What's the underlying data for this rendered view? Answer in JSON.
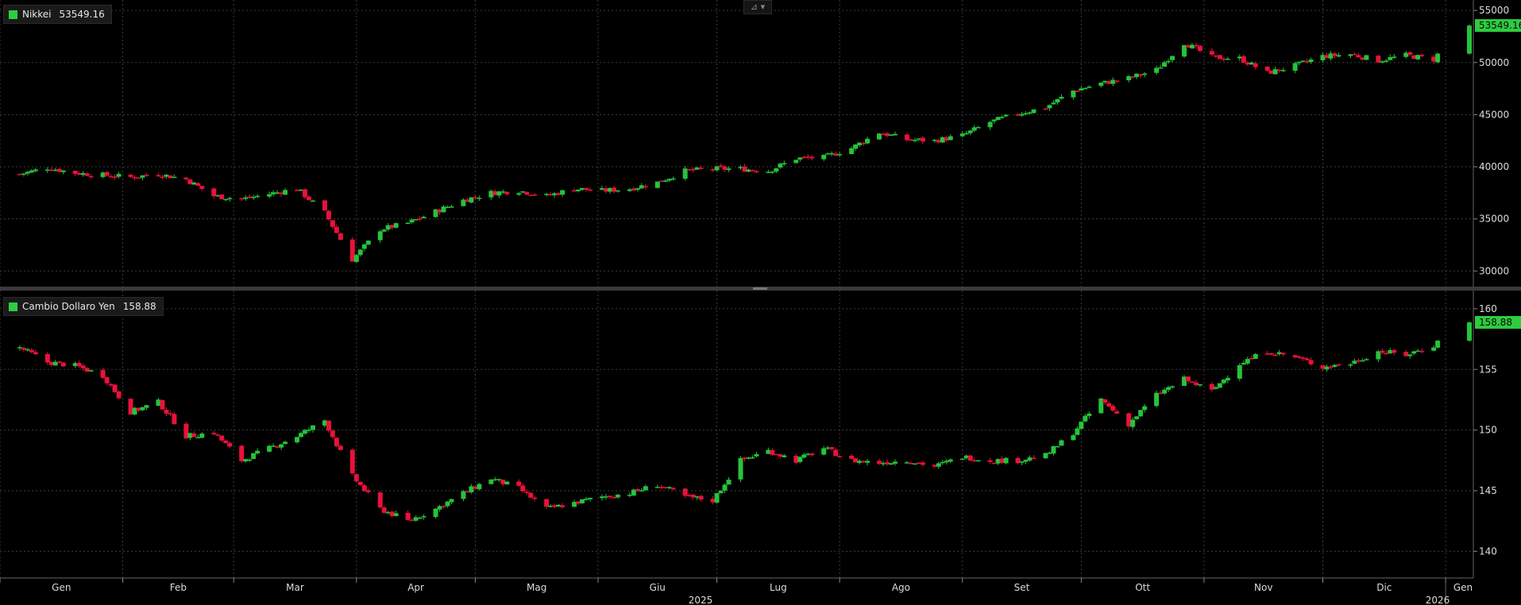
{
  "chart_data": [
    {
      "type": "candlestick",
      "series_name": "Nikkei",
      "last_value": "53549.16",
      "ylim": [
        28500,
        56000
      ],
      "y_ticks": [
        "55000",
        "50000",
        "45000",
        "40000",
        "35000",
        "30000"
      ],
      "grid": true,
      "x": [
        "2025-01-06",
        "2025-01-13",
        "2025-01-20",
        "2025-01-27",
        "2025-02-03",
        "2025-02-10",
        "2025-02-17",
        "2025-02-24",
        "2025-03-03",
        "2025-03-10",
        "2025-03-17",
        "2025-03-24",
        "2025-03-31",
        "2025-04-07",
        "2025-04-14",
        "2025-04-21",
        "2025-04-28",
        "2025-05-05",
        "2025-05-12",
        "2025-05-19",
        "2025-05-26",
        "2025-06-02",
        "2025-06-09",
        "2025-06-16",
        "2025-06-23",
        "2025-06-30",
        "2025-07-07",
        "2025-07-14",
        "2025-07-21",
        "2025-07-28",
        "2025-08-04",
        "2025-08-11",
        "2025-08-18",
        "2025-08-25",
        "2025-09-01",
        "2025-09-08",
        "2025-09-15",
        "2025-09-22",
        "2025-09-29",
        "2025-10-06",
        "2025-10-13",
        "2025-10-20",
        "2025-10-27",
        "2025-11-03",
        "2025-11-10",
        "2025-11-17",
        "2025-11-24",
        "2025-12-01",
        "2025-12-08",
        "2025-12-15",
        "2025-12-22",
        "2025-12-29",
        "2026-01-05"
      ],
      "values": [
        39300,
        39900,
        39400,
        39200,
        39000,
        39300,
        38800,
        37200,
        36900,
        37400,
        37900,
        35600,
        31100,
        34000,
        34600,
        35700,
        36800,
        37500,
        37700,
        37200,
        37900,
        37700,
        37900,
        38500,
        39600,
        39800,
        39800,
        39600,
        40800,
        40900,
        41800,
        43300,
        42600,
        42500,
        43000,
        44300,
        45100,
        45700,
        47300,
        48000,
        48500,
        49300,
        51900,
        50500,
        50400,
        49000,
        49700,
        50600,
        50800,
        50200,
        50700,
        50300,
        53549.16
      ]
    },
    {
      "type": "candlestick",
      "series_name": "Cambio Dollaro Yen",
      "last_value": "158.88",
      "ylim": [
        137.8,
        161.5
      ],
      "y_ticks": [
        "160",
        "155",
        "150",
        "145",
        "140"
      ],
      "grid": true,
      "x": [
        "2025-01-06",
        "2025-01-13",
        "2025-01-20",
        "2025-01-27",
        "2025-02-03",
        "2025-02-10",
        "2025-02-17",
        "2025-02-24",
        "2025-03-03",
        "2025-03-10",
        "2025-03-17",
        "2025-03-24",
        "2025-03-31",
        "2025-04-07",
        "2025-04-14",
        "2025-04-21",
        "2025-04-28",
        "2025-05-05",
        "2025-05-12",
        "2025-05-19",
        "2025-05-26",
        "2025-06-02",
        "2025-06-09",
        "2025-06-16",
        "2025-06-23",
        "2025-06-30",
        "2025-07-07",
        "2025-07-14",
        "2025-07-21",
        "2025-07-28",
        "2025-08-04",
        "2025-08-11",
        "2025-08-18",
        "2025-08-25",
        "2025-09-01",
        "2025-09-08",
        "2025-09-15",
        "2025-09-22",
        "2025-09-29",
        "2025-10-06",
        "2025-10-13",
        "2025-10-20",
        "2025-10-27",
        "2025-11-03",
        "2025-11-10",
        "2025-11-17",
        "2025-11-24",
        "2025-12-01",
        "2025-12-08",
        "2025-12-15",
        "2025-12-22",
        "2025-12-29",
        "2026-01-05"
      ],
      "values": [
        156.8,
        155.6,
        155.3,
        154.5,
        151.5,
        152.3,
        149.5,
        149.8,
        147.5,
        148.5,
        149.5,
        150.8,
        146.2,
        143.5,
        142.5,
        143.5,
        144.8,
        146.0,
        145.2,
        143.5,
        144.0,
        144.5,
        144.8,
        145.5,
        144.5,
        144.2,
        147.5,
        148.3,
        147.5,
        148.5,
        147.5,
        147.3,
        147.5,
        147.0,
        147.8,
        147.5,
        147.5,
        147.9,
        149.8,
        152.5,
        150.5,
        152.9,
        154.2,
        153.2,
        155.5,
        156.5,
        156.0,
        155.2,
        155.5,
        156.5,
        156.2,
        157.0,
        158.88
      ]
    }
  ],
  "x_axis": {
    "month_labels": [
      "Gen",
      "Feb",
      "Mar",
      "Apr",
      "Mag",
      "Giu",
      "Lug",
      "Ago",
      "Set",
      "Ott",
      "Nov",
      "Dic",
      "Gen"
    ],
    "year_labels": [
      "2025",
      "2026"
    ]
  },
  "colors": {
    "background": "#000000",
    "up": "#27c23b",
    "down": "#e8123a",
    "grid": "#3c3c3c",
    "legend_swatch": "#2ecc40",
    "price_tag": "#2ecc40",
    "axis_text": "#dcdcdc",
    "separator": "#4a4a4a"
  },
  "toolbar": {
    "chart_type_icon": "line-chart-icon",
    "chart_type_glyph": "⊿ ▾"
  }
}
